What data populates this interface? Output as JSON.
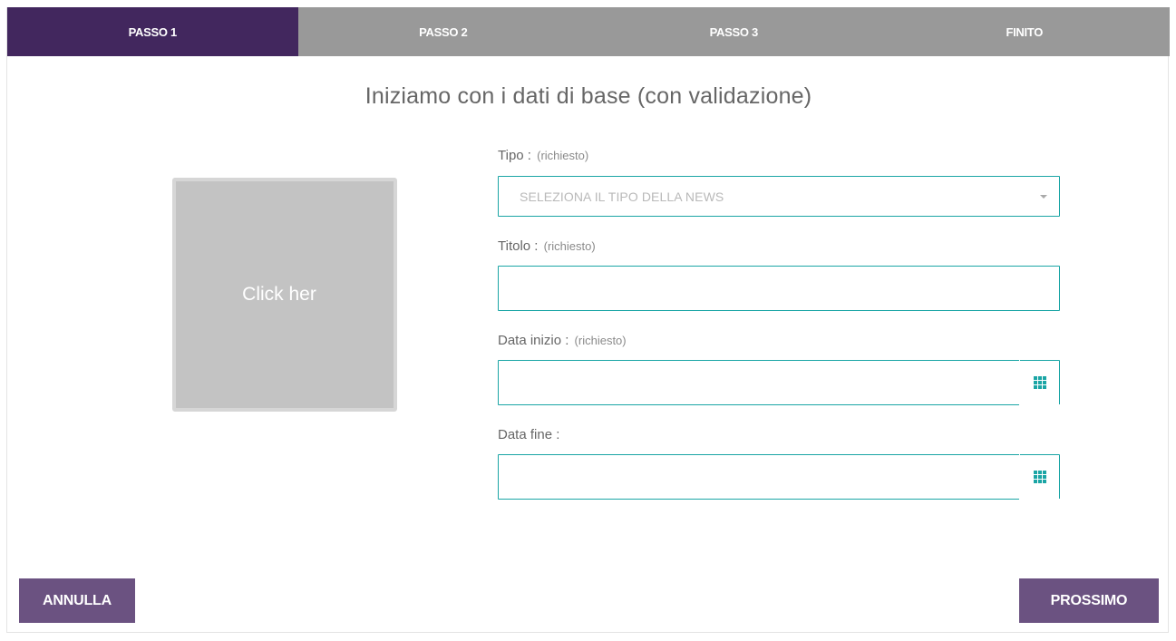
{
  "steps": [
    {
      "label": "PASSO 1",
      "active": true
    },
    {
      "label": "PASSO 2",
      "active": false
    },
    {
      "label": "PASSO 3",
      "active": false
    },
    {
      "label": "FINITO",
      "active": false
    }
  ],
  "title": "Iniziamo con i dati di base (con validazione)",
  "upload": {
    "text": "Click her"
  },
  "fields": {
    "tipo": {
      "label": "Tipo :",
      "required": "(richiesto)",
      "placeholder": "SELEZIONA IL TIPO DELLA NEWS",
      "icon": "chevron-down-icon"
    },
    "titolo": {
      "label": "Titolo :",
      "required": "(richiesto)",
      "value": ""
    },
    "data_inizio": {
      "label": "Data inizio :",
      "required": "(richiesto)",
      "value": "",
      "icon": "calendar-grid-icon"
    },
    "data_fine": {
      "label": "Data fine :",
      "value": "",
      "icon": "calendar-grid-icon"
    }
  },
  "buttons": {
    "cancel": "ANNULLA",
    "next": "PROSSIMO"
  },
  "colors": {
    "active_step": "#42275e",
    "inactive_step": "#999999",
    "accent": "#1aa5a5",
    "button": "#6b5281"
  }
}
